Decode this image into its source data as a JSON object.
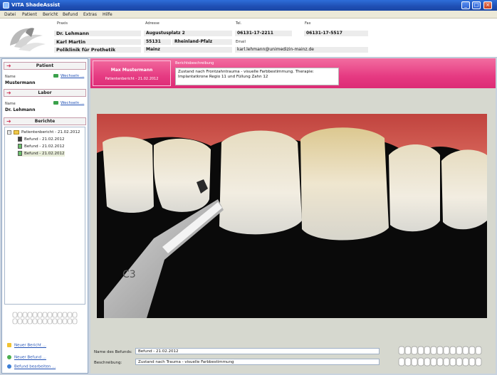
{
  "window": {
    "title": "VITA ShadeAssist",
    "controls": [
      "_",
      "□",
      "×"
    ]
  },
  "menu": [
    "Datei",
    "Patient",
    "Bericht",
    "Befund",
    "Extras",
    "Hilfe"
  ],
  "header": {
    "praxis_label": "Praxis",
    "adresse_label": "Adresse",
    "tel_label": "Tel.",
    "fax_label": "Fax",
    "email_label": "Email",
    "praxis_name": "Dr. Lehmann",
    "praxis_person": "Karl Martin",
    "praxis_org": "Poliklinik für Prothetik",
    "street": "Augustusplatz 2",
    "zip": "55131",
    "state": "Rheinland-Pfalz",
    "city": "Mainz",
    "tel": "06131-17-2211",
    "fax": "06131-17-5517",
    "email": "karl.lehmann@unimedizin-mainz.de"
  },
  "patient": {
    "heading": "Patient",
    "name_label": "Name",
    "name": "Mustermann",
    "change": "Wechseln ..."
  },
  "labor": {
    "heading": "Labor",
    "name_label": "Name",
    "name": "Dr. Lehmann",
    "change": "Wechseln ..."
  },
  "berichte": {
    "heading": "Berichte",
    "root": "Patientenbericht - 21.02.2012",
    "items": [
      "Befund - 21.02.2012",
      "Befund - 21.02.2012",
      "Befund - 21.02.2012"
    ]
  },
  "bottom_links": {
    "new_report": "Neuer Bericht ...",
    "new_finding": "Neuer Befund ...",
    "edit_finding": "Befund bearbeiten ..."
  },
  "banner": {
    "patient": "Max Mustermann",
    "report": "Patientenbericht - 21.02.2012",
    "desc_label": "Berichtsbeschreibung",
    "desc_text": "Zustand nach Frontzahntrauma - visuelle Farbbestimmung. Therapie: Implantatkrone Regio 11 und Füllung Zahn 12"
  },
  "finding": {
    "name_label": "Name des Befunds:",
    "name_value": "Befund - 21.02.2012",
    "desc_label": "Beschreibung:",
    "desc_value": "Zustand nach Trauma - visuelle Farbbestimmung"
  },
  "colors": {
    "accent_pink": "#e63a82",
    "titlebar_blue": "#1f4fb4",
    "link_blue": "#1f4fb4"
  }
}
